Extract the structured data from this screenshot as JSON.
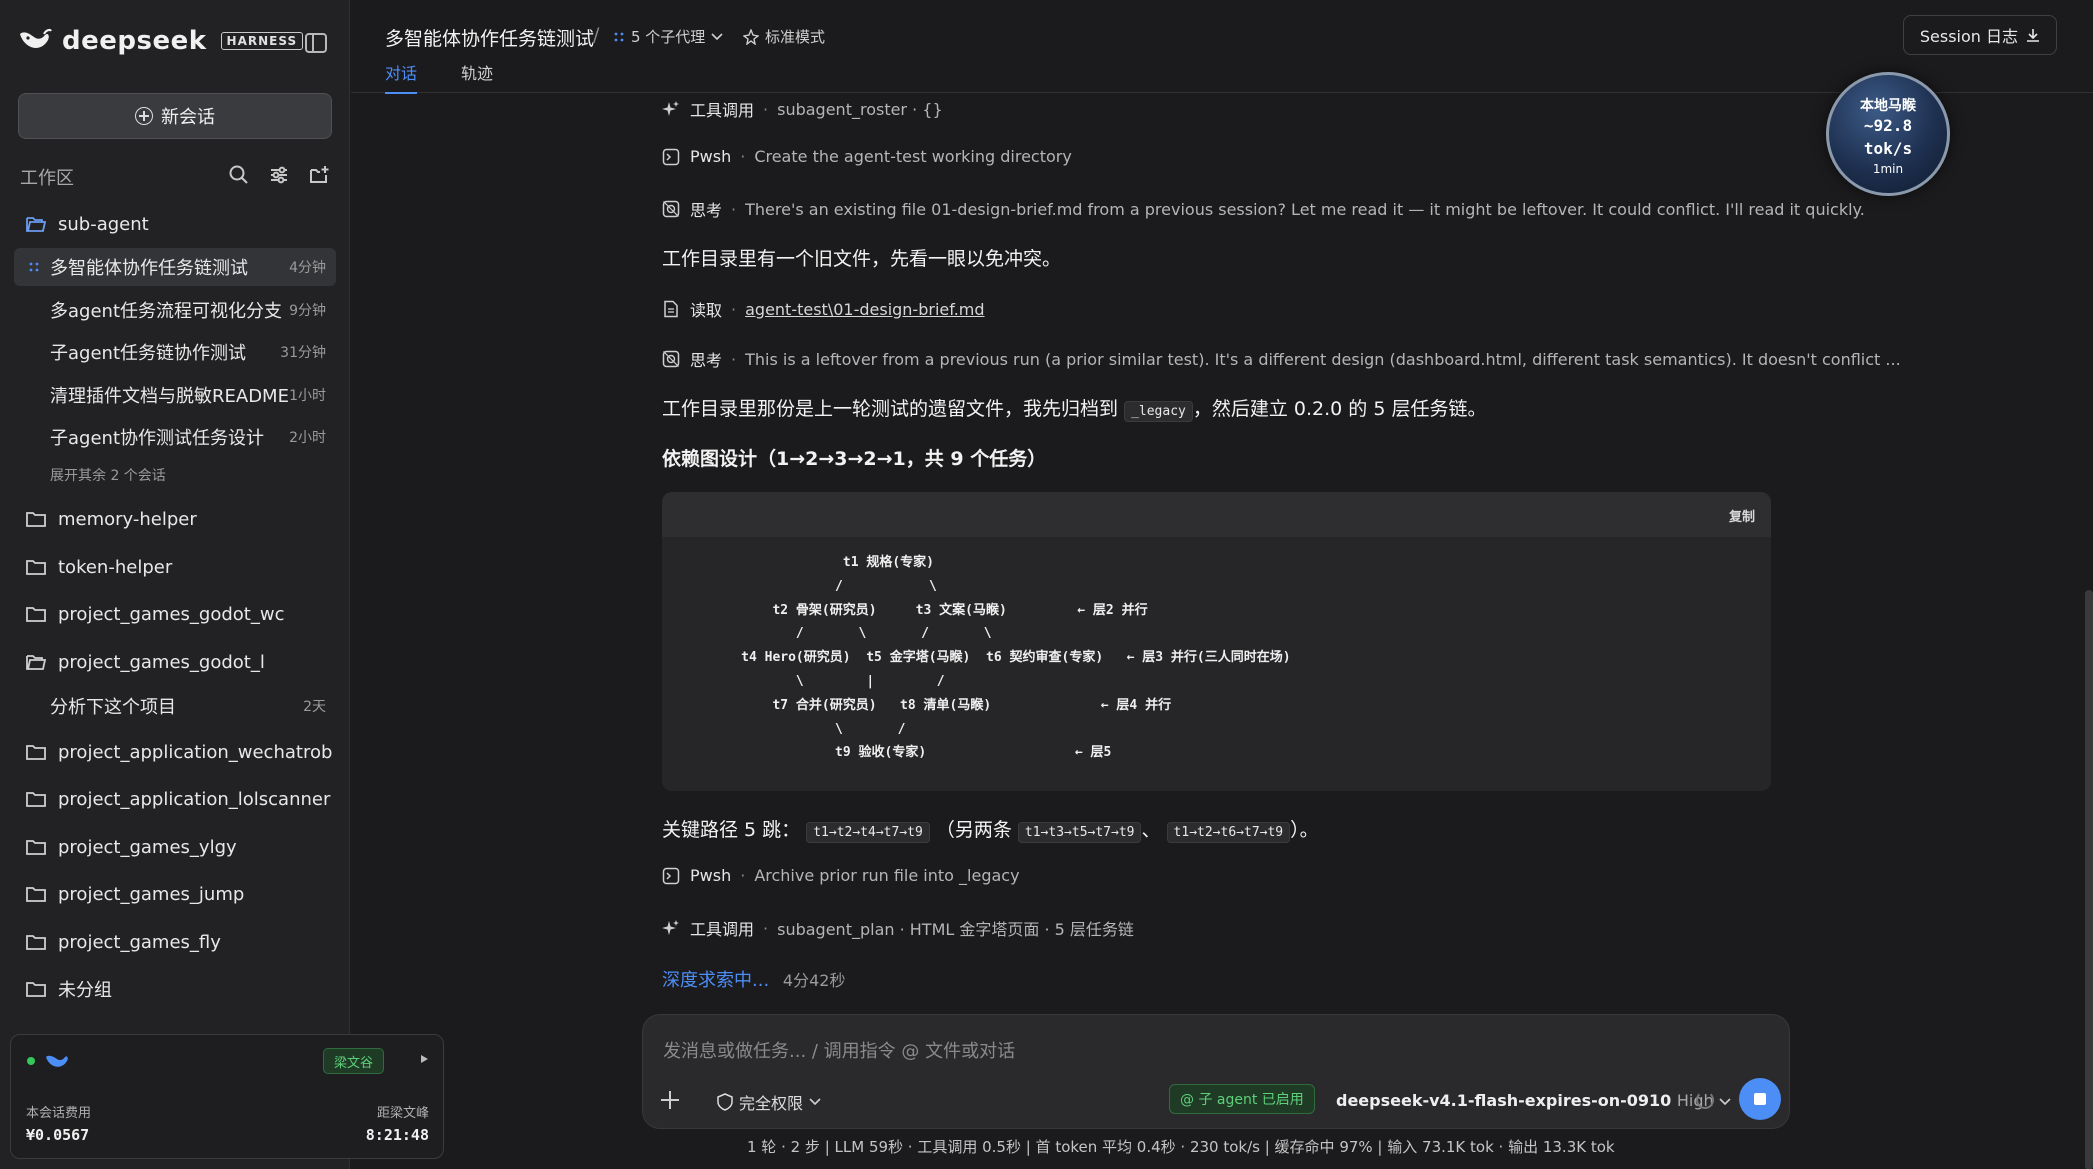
{
  "brand": {
    "name": "deepseek",
    "badge": "HARNESS"
  },
  "sidebar": {
    "new_chat": "新会话",
    "workspace_title": "工作区",
    "folders": [
      {
        "name": "sub-agent",
        "open": true
      },
      {
        "name": "memory-helper"
      },
      {
        "name": "token-helper"
      },
      {
        "name": "project_games_godot_wc"
      },
      {
        "name": "project_games_godot_l",
        "open": true
      },
      {
        "name": "project_application_wechatrob"
      },
      {
        "name": "project_application_lolscanner"
      },
      {
        "name": "project_games_ylgy"
      },
      {
        "name": "project_games_jump"
      },
      {
        "name": "project_games_fly"
      },
      {
        "name": "未分组"
      }
    ],
    "sessions": [
      {
        "title": "多智能体协作任务链测试",
        "time": "4分钟"
      },
      {
        "title": "多agent任务流程可视化分支",
        "time": "9分钟"
      },
      {
        "title": "子agent任务链协作测试",
        "time": "31分钟"
      },
      {
        "title": "清理插件文档与脱敏README",
        "time": "1小时"
      },
      {
        "title": "子agent协作测试任务设计",
        "time": "2小时"
      }
    ],
    "more": "展开其余 2 个会话",
    "godot_session": {
      "title": "分析下这个项目",
      "time": "2天"
    }
  },
  "cost_card": {
    "tag": "梁文谷",
    "cost_label": "本会话费用",
    "cost_value": "¥0.0567",
    "timer_label": "距梁文峰",
    "timer_value": "8:21:48"
  },
  "topbar": {
    "title": "多智能体协作任务链测试",
    "separator": "/",
    "agents": "5 个子代理",
    "mode": "标准模式",
    "tabs": [
      "对话",
      "轨迹"
    ],
    "session_log": "Session 日志"
  },
  "speed": {
    "name": "本地马睺",
    "value": "~92.8",
    "unit": "tok/s",
    "window": "1min"
  },
  "transcript": {
    "rows": [
      {
        "kind": "工具调用",
        "detail": "subagent_roster · {}"
      },
      {
        "kind": "Pwsh",
        "detail": "Create the agent-test working directory"
      },
      {
        "kind": "思考",
        "detail": "There's an existing file 01-design-brief.md from a previous session? Let me read it — it might be leftover. It could conflict. I'll read it quickly."
      },
      {
        "kind": "读取",
        "detail": "agent-test\\01-design-brief.md"
      },
      {
        "kind": "思考",
        "detail": "This is a leftover from a previous run (a prior similar test). It's a different design (dashboard.html, different task semantics). It doesn't conflict ..."
      },
      {
        "kind": "Pwsh",
        "detail": "Archive prior run file into _legacy"
      },
      {
        "kind": "工具调用",
        "detail": "subagent_plan · HTML 金字塔页面 · 5 层任务链"
      }
    ],
    "para1": "工作目录里有一个旧文件，先看一眼以免冲突。",
    "para2_a": "工作目录里那份是上一轮测试的遗留文件，我先归档到",
    "para2_code": "_legacy",
    "para2_b": "，然后建立 0.2.0 的 5 层任务链。",
    "heading": "依赖图设计（1→2→3→2→1，共 9 个任务）",
    "code_copy": "复制",
    "code": "                  t1 规格(专家)\n                 /           \\\n         t2 骨架(研究员)     t3 文案(马睺)         ← 层2 并行\n            /       \\       /       \\\n     t4 Hero(研究员)  t5 金字塔(马睺)  t6 契约审查(专家)   ← 层3 并行(三人同时在场)\n            \\        |        /\n         t7 合并(研究员)   t8 清单(马睺)              ← 层4 并行\n                 \\       /\n                 t9 验收(专家)                   ← 层5",
    "path_label": "关键路径 5 跳：",
    "path_main": "t1→t2→t4→t7→t9",
    "path_mid": "（另两条",
    "path_alt1": "t1→t3→t5→t7→t9",
    "path_sep": "、",
    "path_alt2": "t1→t2→t6→t7→t9",
    "path_end": "）。",
    "thinking": "深度求索中...",
    "elapsed": "4分42秒"
  },
  "composer": {
    "placeholder": "发消息或做任务... / 调用指令 @ 文件或对话",
    "permission": "完全权限",
    "subagent": "@ 子 agent 已启用",
    "model": "deepseek-v4.1-flash-expires-on-0910",
    "level": "High"
  },
  "statusbar": "1 轮 · 2 步  |  LLM 59秒 · 工具调用 0.5秒  |  首 token 平均 0.4秒 · 230 tok/s  |  缓存命中 97%  |  输入 73.1K tok · 输出 13.3K tok",
  "colors": {
    "accent": "#4c8df6",
    "success": "#5fd07a",
    "bg": "#1b1b1d",
    "sidebar": "#222224"
  }
}
